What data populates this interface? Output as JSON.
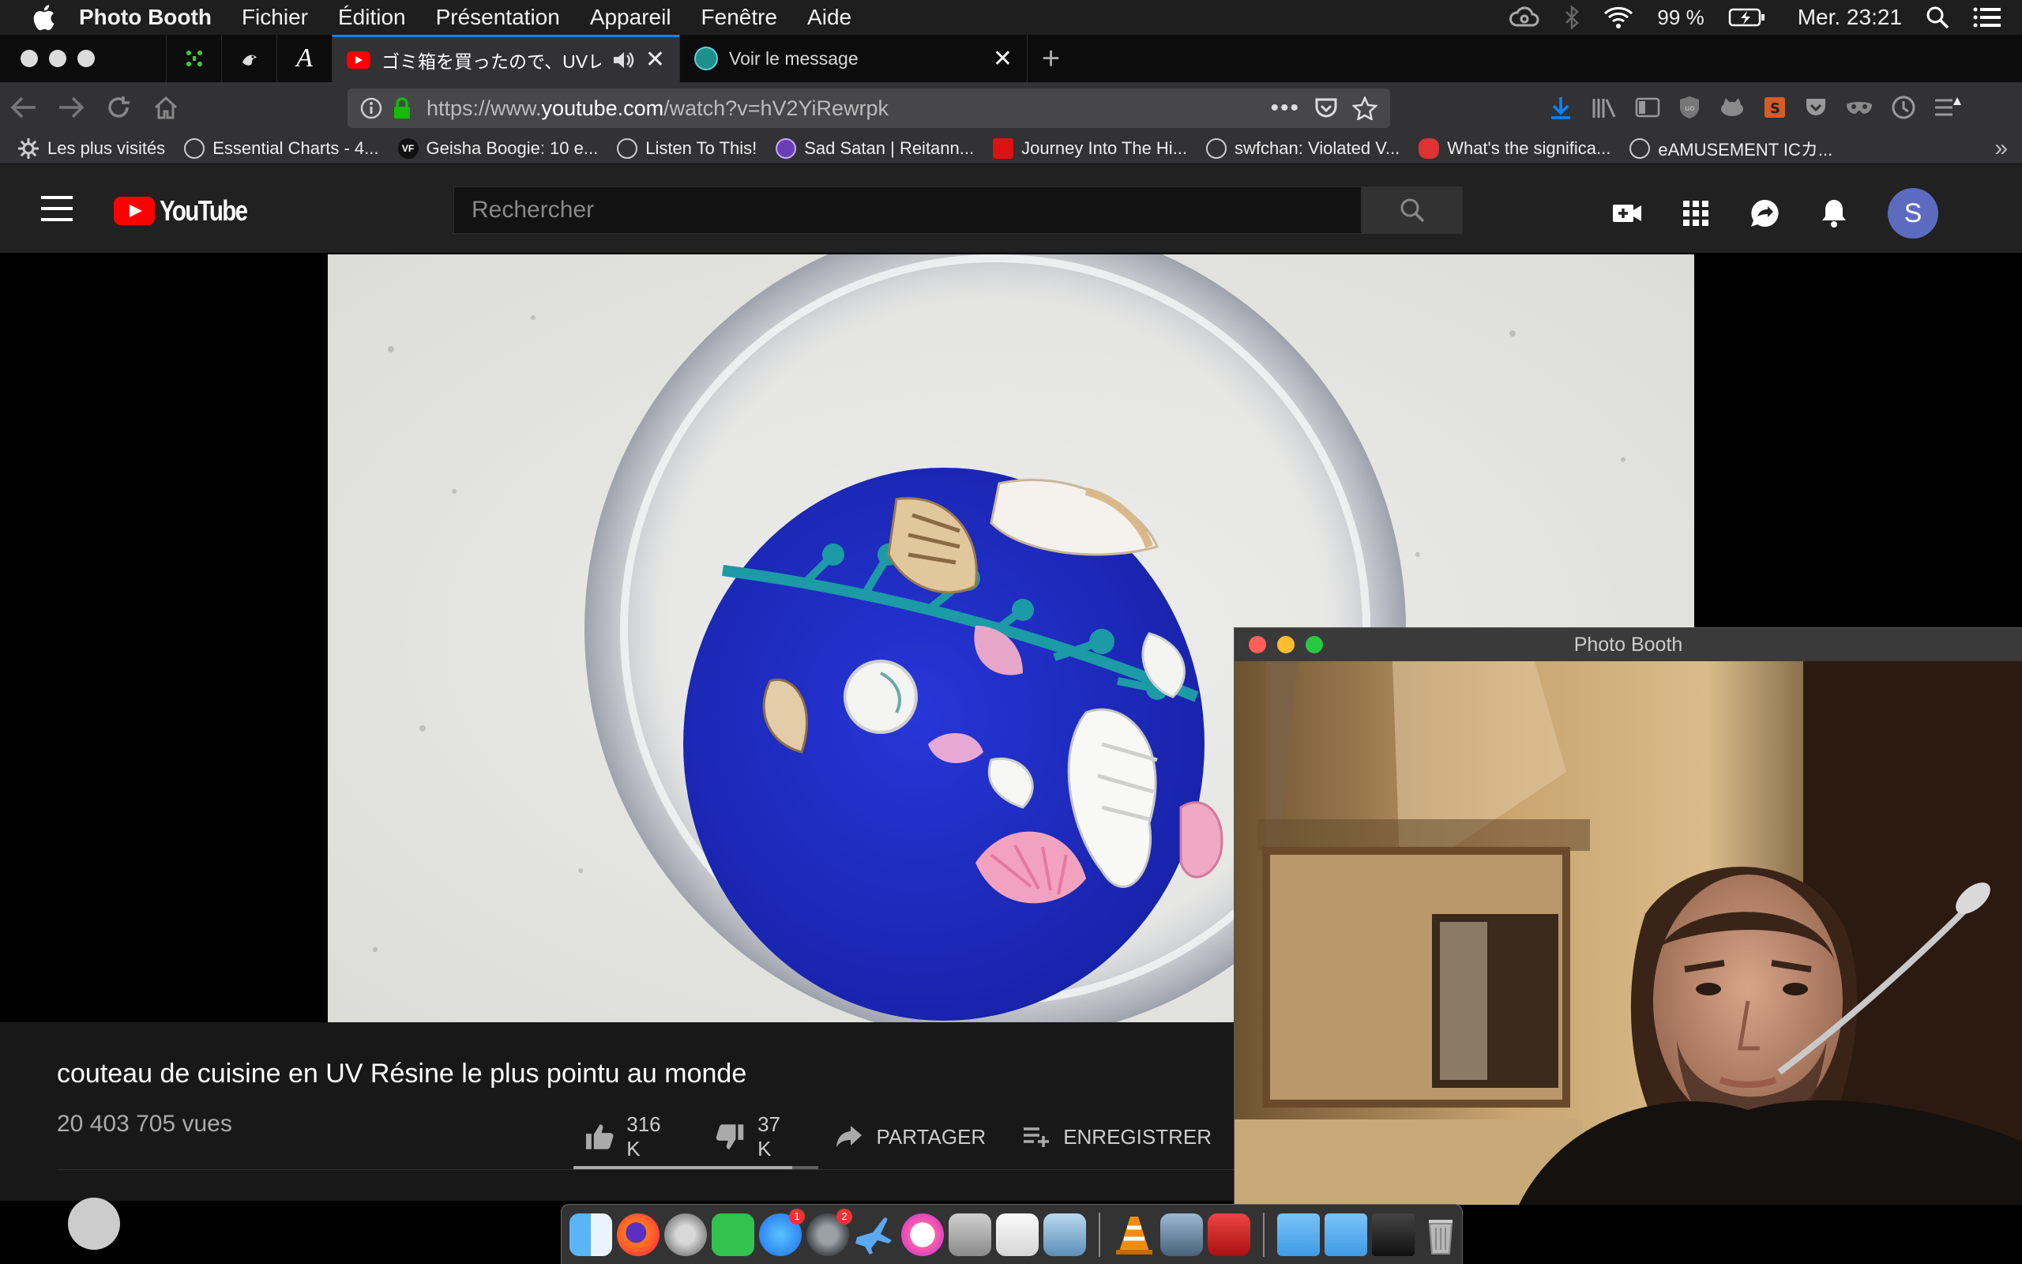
{
  "menubar": {
    "app_name": "Photo Booth",
    "items": [
      "Fichier",
      "Édition",
      "Présentation",
      "Appareil",
      "Fenêtre",
      "Aide"
    ],
    "battery": "99 %",
    "clock": "Mer. 23:21"
  },
  "browser": {
    "tabs": [
      {
        "title": "ゴミ箱を買ったので、UVレジンで",
        "active": true,
        "audio": true
      },
      {
        "title": "Voir le message",
        "active": false
      }
    ],
    "url_prefix": "https://www.",
    "url_host": "youtube.com",
    "url_path": "/watch?v=hV2YiRewrpk",
    "bookmarks": [
      {
        "label": "Les plus visités",
        "icon": "gear-icon"
      },
      {
        "label": "Essential Charts - 4...",
        "icon": "globe-icon"
      },
      {
        "label": "Geisha Boogie: 10 e...",
        "icon": "vf-icon",
        "icon_text": "VF"
      },
      {
        "label": "Listen To This!",
        "icon": "globe-icon"
      },
      {
        "label": "Sad Satan | Reitann...",
        "icon": "purple-icon"
      },
      {
        "label": "Journey Into The Hi...",
        "icon": "red-icon"
      },
      {
        "label": "swfchan: Violated V...",
        "icon": "globe-icon"
      },
      {
        "label": "What's the significa...",
        "icon": "orange-icon"
      },
      {
        "label": "eAMUSEMENT ICカ...",
        "icon": "globe-icon"
      }
    ]
  },
  "youtube": {
    "logo_text": "YouTube",
    "search_placeholder": "Rechercher",
    "avatar_letter": "S",
    "video": {
      "title": "couteau de cuisine en UV Résine le plus pointu au monde",
      "views": "20 403 705 vues",
      "likes": "316 K",
      "dislikes": "37 K",
      "share_label": "PARTAGER",
      "save_label": "ENREGISTRER",
      "like_ratio": 0.895
    }
  },
  "photobooth": {
    "title": "Photo Booth"
  },
  "colors": {
    "accent": "#0a84ff",
    "youtube_red": "#ff0000",
    "sand_blue": "#1f2fd0",
    "stem_teal": "#1c9aa6"
  }
}
